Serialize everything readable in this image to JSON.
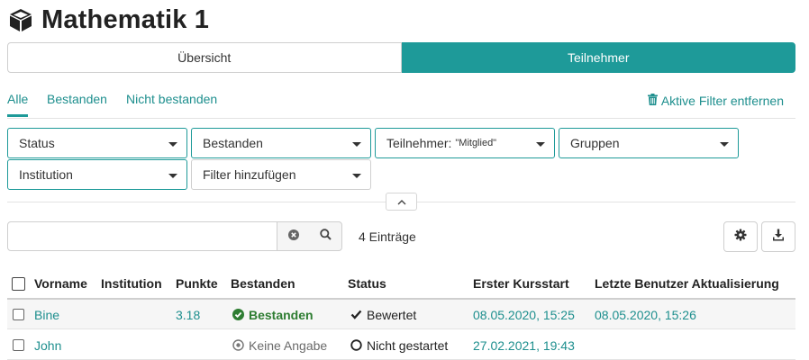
{
  "header": {
    "title": "Mathematik 1",
    "icon": "cube-icon"
  },
  "segments": [
    {
      "label": "Übersicht",
      "active": false
    },
    {
      "label": "Teilnehmer",
      "active": true
    }
  ],
  "tabs": [
    {
      "label": "Alle",
      "active": true
    },
    {
      "label": "Bestanden",
      "active": false
    },
    {
      "label": "Nicht bestanden",
      "active": false
    }
  ],
  "remove_filters": {
    "label": "Aktive Filter entfernen",
    "icon": "trash-icon"
  },
  "filters": {
    "status": "Status",
    "bestanden": "Bestanden",
    "teilnehmer": "Teilnehmer:",
    "teilnehmer_value": "\"Mitglied\"",
    "gruppen": "Gruppen",
    "institution": "Institution",
    "add_filter": "Filter hinzufügen"
  },
  "search": {
    "value": "",
    "placeholder": ""
  },
  "entries": "4 Einträge",
  "table": {
    "columns": [
      "Vorname",
      "Institution",
      "Punkte",
      "Bestanden",
      "Status",
      "Erster Kursstart",
      "Letzte Benutzer Aktualisierung"
    ],
    "rows": [
      {
        "vorname": "Bine",
        "institution": "",
        "punkte": "3.18",
        "bestanden": "Bestanden",
        "status": "Bewertet",
        "erster": "08.05.2020, 15:25",
        "letzte": "08.05.2020, 15:26"
      },
      {
        "vorname": "John",
        "institution": "",
        "punkte": "",
        "bestanden": "Keine Angabe",
        "status": "Nicht gestartet",
        "erster": "27.02.2021, 19:43",
        "letzte": ""
      }
    ]
  },
  "colors": {
    "accent": "#1e9a99",
    "link": "#1e8f8e",
    "passed": "#2e7d32"
  }
}
